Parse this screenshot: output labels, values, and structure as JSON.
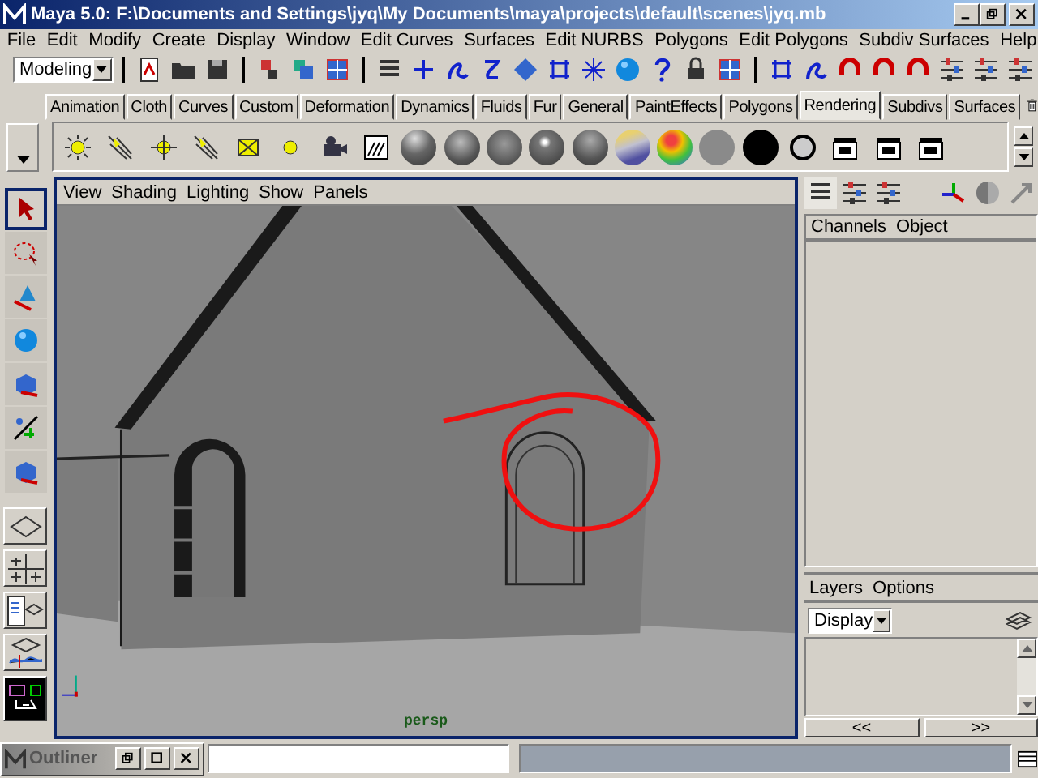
{
  "window": {
    "title": "Maya 5.0: F:\\Documents and Settings\\jyq\\My Documents\\maya\\projects\\default\\scenes\\jyq.mb"
  },
  "menu_bar": [
    "File",
    "Edit",
    "Modify",
    "Create",
    "Display",
    "Window",
    "Edit Curves",
    "Surfaces",
    "Edit NURBS",
    "Polygons",
    "Edit Polygons",
    "Subdiv Surfaces",
    "Help"
  ],
  "status_line": {
    "mode": "Modeling"
  },
  "shelf_tabs": [
    {
      "label": "Animation",
      "selected": false
    },
    {
      "label": "Cloth",
      "selected": false
    },
    {
      "label": "Curves",
      "selected": false
    },
    {
      "label": "Custom",
      "selected": false
    },
    {
      "label": "Deformation",
      "selected": false
    },
    {
      "label": "Dynamics",
      "selected": false
    },
    {
      "label": "Fluids",
      "selected": false
    },
    {
      "label": "Fur",
      "selected": false
    },
    {
      "label": "General",
      "selected": false
    },
    {
      "label": "PaintEffects",
      "selected": false
    },
    {
      "label": "Polygons",
      "selected": false
    },
    {
      "label": "Rendering",
      "selected": true
    },
    {
      "label": "Subdivs",
      "selected": false
    },
    {
      "label": "Surfaces",
      "selected": false
    }
  ],
  "viewport": {
    "menus": [
      "View",
      "Shading",
      "Lighting",
      "Show",
      "Panels"
    ],
    "camera": "persp"
  },
  "channel_box": {
    "menus": [
      "Channels",
      "Object"
    ]
  },
  "layer_editor": {
    "menus": [
      "Layers",
      "Options"
    ],
    "layer_type": "Display",
    "nav_buttons": [
      "<<",
      ">>"
    ]
  },
  "outliner": {
    "title": "Outliner"
  }
}
